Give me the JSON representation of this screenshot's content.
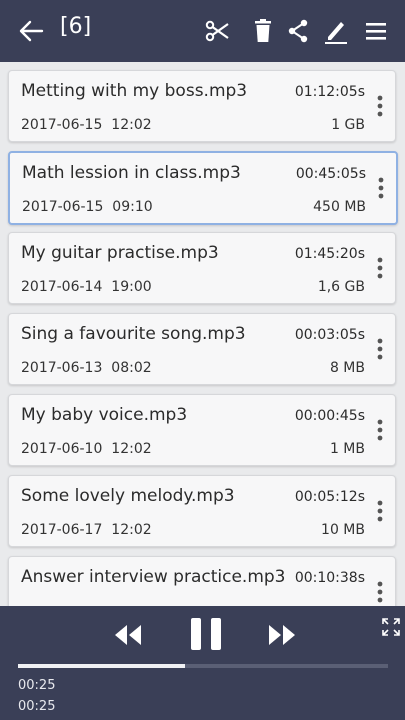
{
  "header": {
    "count_label": "[6]"
  },
  "files": [
    {
      "name": "Metting with my boss.mp3",
      "duration": "01:12:05s",
      "date": "2017-06-15",
      "time": "12:02",
      "size": "1 GB"
    },
    {
      "name": "Math lession in class.mp3",
      "duration": "00:45:05s",
      "date": "2017-06-15",
      "time": "09:10",
      "size": "450 MB",
      "selected": true
    },
    {
      "name": "My guitar practise.mp3",
      "duration": "01:45:20s",
      "date": "2017-06-14",
      "time": "19:00",
      "size": "1,6 GB"
    },
    {
      "name": "Sing a favourite song.mp3",
      "duration": "00:03:05s",
      "date": "2017-06-13",
      "time": "08:02",
      "size": "8 MB"
    },
    {
      "name": "My baby voice.mp3",
      "duration": "00:00:45s",
      "date": "2017-06-10",
      "time": "12:02",
      "size": "1 MB"
    },
    {
      "name": "Some lovely melody.mp3",
      "duration": "00:05:12s",
      "date": "2017-06-17",
      "time": "12:02",
      "size": "10 MB"
    },
    {
      "name": "Answer interview practice.mp3",
      "duration": "00:10:38s",
      "date": "",
      "time": "",
      "size": ""
    }
  ],
  "player": {
    "progress": 0.45,
    "time_current": "00:25",
    "time_total": "00:25"
  },
  "colors": {
    "bar_background": "#3a3f57",
    "selected_border": "#8fb1e3"
  }
}
